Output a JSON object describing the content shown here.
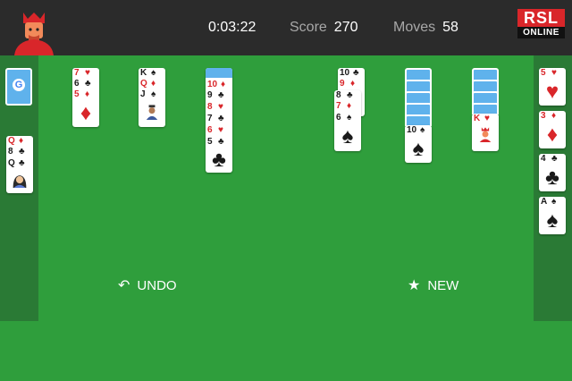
{
  "header": {
    "timer": "0:03:22",
    "score_label": "Score",
    "score_value": "270",
    "moves_label": "Moves",
    "moves_value": "58",
    "logo_line1": "RSL",
    "logo_line2": "ONLINE"
  },
  "stock": {
    "icon": "google-g-icon",
    "glyph": "G"
  },
  "waste": [
    {
      "rank": "Q",
      "suit": "♦",
      "color": "red"
    },
    {
      "rank": "8",
      "suit": "♣",
      "color": "black"
    },
    {
      "rank": "Q",
      "suit": "♣",
      "color": "black"
    }
  ],
  "tableau": {
    "col1": [
      {
        "rank": "7",
        "suit": "♥",
        "color": "red"
      },
      {
        "rank": "6",
        "suit": "♣",
        "color": "black"
      },
      {
        "rank": "5",
        "suit": "♦",
        "color": "red"
      }
    ],
    "col2": [
      {
        "rank": "K",
        "suit": "♠",
        "color": "black"
      },
      {
        "rank": "Q",
        "suit": "♦",
        "color": "red"
      },
      {
        "rank": "J",
        "suit": "♠",
        "color": "black"
      }
    ],
    "col3": [
      {
        "rank": "10",
        "suit": "♦",
        "color": "red"
      },
      {
        "rank": "9",
        "suit": "♣",
        "color": "black"
      },
      {
        "rank": "8",
        "suit": "♥",
        "color": "red"
      },
      {
        "rank": "7",
        "suit": "♣",
        "color": "black"
      },
      {
        "rank": "6",
        "suit": "♥",
        "color": "red"
      },
      {
        "rank": "5",
        "suit": "♣",
        "color": "black"
      }
    ],
    "col4": [
      {
        "rank": "10",
        "suit": "♣",
        "color": "black"
      },
      {
        "rank": "9",
        "suit": "♦",
        "color": "red"
      },
      {
        "rank": "8",
        "suit": "♣",
        "color": "black"
      },
      {
        "rank": "7",
        "suit": "♦",
        "color": "red"
      },
      {
        "rank": "6",
        "suit": "♠",
        "color": "black"
      }
    ],
    "col5": [
      {
        "rank": "10",
        "suit": "♠",
        "color": "black"
      }
    ],
    "col6": [
      {
        "rank": "K",
        "suit": "♥",
        "color": "red"
      }
    ]
  },
  "foundations": [
    {
      "rank": "5",
      "suit": "♥",
      "color": "red"
    },
    {
      "rank": "3",
      "suit": "♦",
      "color": "red"
    },
    {
      "rank": "4",
      "suit": "♣",
      "color": "black"
    },
    {
      "rank": "A",
      "suit": "♠",
      "color": "black"
    }
  ],
  "actions": {
    "undo_label": "UNDO",
    "undo_icon": "undo-arrow-icon",
    "new_label": "NEW",
    "new_icon": "star-icon"
  },
  "colors": {
    "felt": "#2f9e3c",
    "side": "#2a7a35",
    "topbar": "#2b2b2b",
    "card_back": "#5fb2ec",
    "red_suit": "#d9262a"
  }
}
